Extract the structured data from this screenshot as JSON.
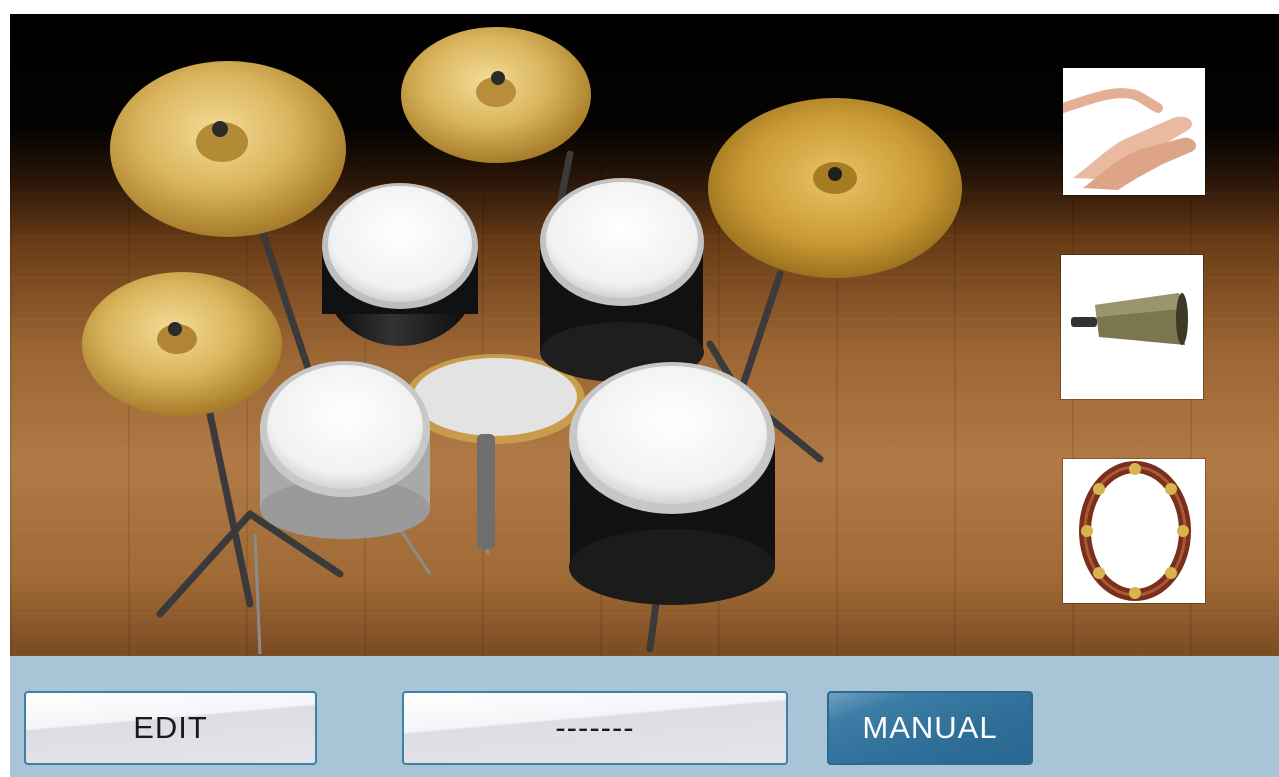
{
  "drum_kit": {
    "pieces": [
      {
        "name": "crash-cymbal-left"
      },
      {
        "name": "splash-cymbal-top"
      },
      {
        "name": "ride-cymbal-right"
      },
      {
        "name": "hihat-cymbal"
      },
      {
        "name": "tom-left"
      },
      {
        "name": "tom-right"
      },
      {
        "name": "snare-drum"
      },
      {
        "name": "bass-drum"
      },
      {
        "name": "floor-tom"
      }
    ]
  },
  "side_instruments": [
    {
      "name": "hand-clap"
    },
    {
      "name": "cowbell"
    },
    {
      "name": "tambourine"
    }
  ],
  "bottom_bar": {
    "edit_label": "EDIT",
    "pattern_label": "-------",
    "manual_label": "MANUAL"
  },
  "colors": {
    "bar_bg": "#a9c4d6",
    "button_border": "#3f7fa8",
    "active_button": "#2f6f98",
    "cymbal_gold": "#d9b45c"
  }
}
